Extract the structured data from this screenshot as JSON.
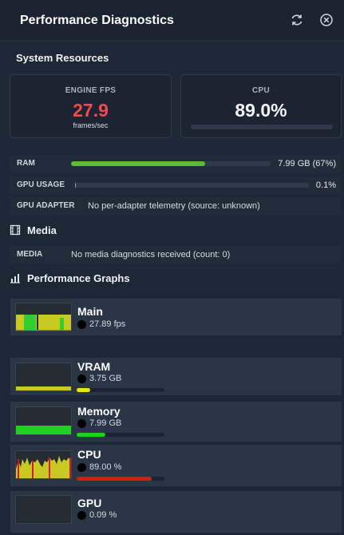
{
  "header": {
    "title": "Performance Diagnostics",
    "refresh_icon": "refresh-icon",
    "close_icon": "close-circle-icon"
  },
  "system": {
    "heading": "System Resources",
    "fps": {
      "label": "ENGINE FPS",
      "value": "27.9",
      "unit": "frames/sec",
      "color": "#ef4d4d"
    },
    "cpu": {
      "label": "CPU",
      "value": "89.0%",
      "fraction": 0
    },
    "ram": {
      "label": "RAM",
      "value": "7.99 GB (67%)",
      "fraction": 0.67,
      "color": "#5ac02c"
    },
    "gpu_usage": {
      "label": "GPU USAGE",
      "value": "0.1%",
      "fraction": 0.001
    },
    "gpu_adapter": {
      "label": "GPU ADAPTER",
      "value": "No per-adapter telemetry (source: unknown)"
    }
  },
  "media": {
    "heading": "Media",
    "icon": "film-icon",
    "row": {
      "label": "MEDIA",
      "value": "No media diagnostics received (count: 0)"
    }
  },
  "graphs": {
    "heading": "Performance Graphs",
    "icon": "bar-chart-icon",
    "items": [
      {
        "name": "Main",
        "value": "27.89 fps"
      },
      {
        "name": "VRAM",
        "value": "3.75 GB",
        "fraction": 0.15,
        "color": "#e6e619"
      },
      {
        "name": "Memory",
        "value": "7.99 GB",
        "fraction": 0.33,
        "color": "#1fd11f"
      },
      {
        "name": "CPU",
        "value": "89.00 %",
        "fraction": 0.85,
        "color": "#e01515"
      },
      {
        "name": "GPU",
        "value": "0.09 %",
        "fraction": 0.0
      }
    ]
  }
}
